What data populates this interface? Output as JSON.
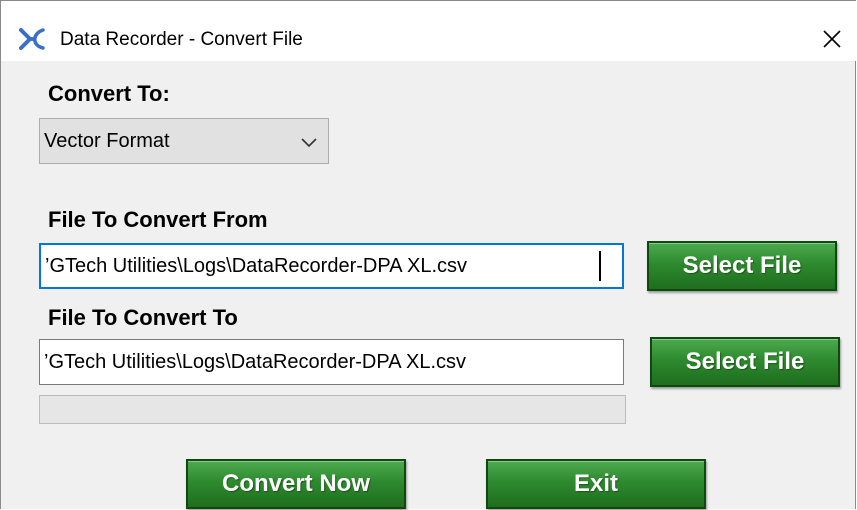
{
  "window": {
    "title": "Data Recorder - Convert File",
    "icon": "app-logo-icon",
    "close_icon": "close-icon"
  },
  "convert_to": {
    "label": "Convert To:",
    "selected": "Vector Format"
  },
  "file_from": {
    "label": "File To Convert From",
    "value": "’GTech Utilities\\Logs\\DataRecorder-DPA XL.csv",
    "button_label": "Select File"
  },
  "file_to": {
    "label": "File To Convert To",
    "value": "’GTech Utilities\\Logs\\DataRecorder-DPA XL.csv",
    "button_label": "Select File"
  },
  "progress": {
    "value": 0
  },
  "actions": {
    "convert_label": "Convert Now",
    "exit_label": "Exit"
  },
  "colors": {
    "button_green": "#2e8a2e",
    "focus_border": "#0078d7",
    "dialog_background": "#f0f0f0"
  }
}
